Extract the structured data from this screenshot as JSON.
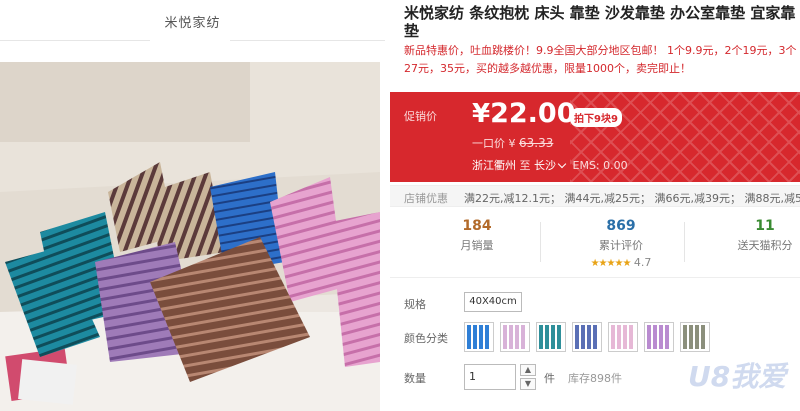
{
  "shop": {
    "name": "米悦家纺"
  },
  "product": {
    "title": "米悦家纺 条纹抱枕 床头 靠垫 沙发靠垫 办公室靠垫 宜家靠垫",
    "subtitle": "新品特惠价，吐血跳楼价！9.9全国大部分地区包邮！ 1个9.9元，2个19元，3个27元，35元，买的越多越优惠，限量1000个，卖完即止！"
  },
  "price": {
    "label": "促销价",
    "currency": "¥",
    "value": "22.00",
    "badge": "拍下9块9",
    "original_label": "一口价",
    "original_currency": "¥",
    "original_value": "63.33",
    "ship_from": "浙江衢州",
    "ship_to_label": "至",
    "ship_to": "长沙",
    "ems": "EMS: 0.00"
  },
  "promo": {
    "label": "店铺优惠",
    "text": "满22元,减12.1元；  满44元,减25元；  满66元,减39元；  满88元,减53元；"
  },
  "stats": {
    "monthly_sales": {
      "value": "184",
      "label": "月销量"
    },
    "reviews": {
      "value": "869",
      "label": "累计评价",
      "stars": "★★★★★",
      "rating": "4.7"
    },
    "points": {
      "value": "11",
      "label": "送天猫积分"
    }
  },
  "spec": {
    "size_label": "规格",
    "size_value": "40X40cm",
    "color_label": "颜色分类",
    "colors": [
      "#2f7fd6",
      "#d8b2d8",
      "#2e8f9a",
      "#5a6fb5",
      "#e6b8d6",
      "#b98bd0",
      "#8b8f7c"
    ]
  },
  "quantity": {
    "label": "数量",
    "value": "1",
    "unit": "件",
    "stock": "库存898件",
    "up": "▲",
    "down": "▼"
  },
  "watermark": "U8我爱"
}
